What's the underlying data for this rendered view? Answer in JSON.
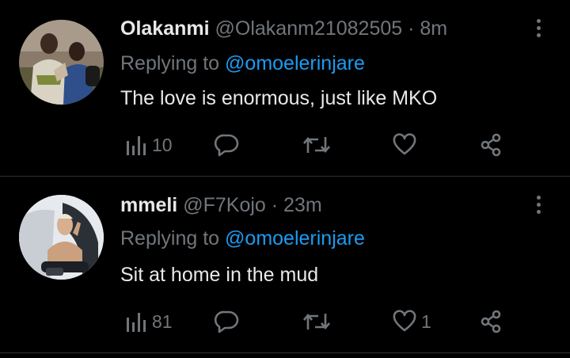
{
  "tweets": [
    {
      "name": "Olakanmi",
      "handle": "@Olakanm21082505",
      "dot": "·",
      "time": "8m",
      "replying_prefix": "Replying to ",
      "replying_to": "@omoelerinjare",
      "text": "The love is enormous, just like MKO",
      "views": "10",
      "replies": "",
      "retweets": "",
      "likes": "",
      "icons": [
        "views-icon",
        "reply-icon",
        "retweet-icon",
        "like-icon",
        "share-icon",
        "more-icon"
      ]
    },
    {
      "name": "mmeli",
      "handle": "@F7Kojo",
      "dot": "·",
      "time": "23m",
      "replying_prefix": "Replying to ",
      "replying_to": "@omoelerinjare",
      "text": "Sit at home in the mud",
      "views": "81",
      "replies": "",
      "retweets": "",
      "likes": "1",
      "icons": [
        "views-icon",
        "reply-icon",
        "retweet-icon",
        "like-icon",
        "share-icon",
        "more-icon"
      ]
    }
  ],
  "colors": {
    "background": "#000000",
    "text": "#e7e9ea",
    "muted": "#71767b",
    "link": "#1d9bf0",
    "separator": "#2f3336"
  }
}
